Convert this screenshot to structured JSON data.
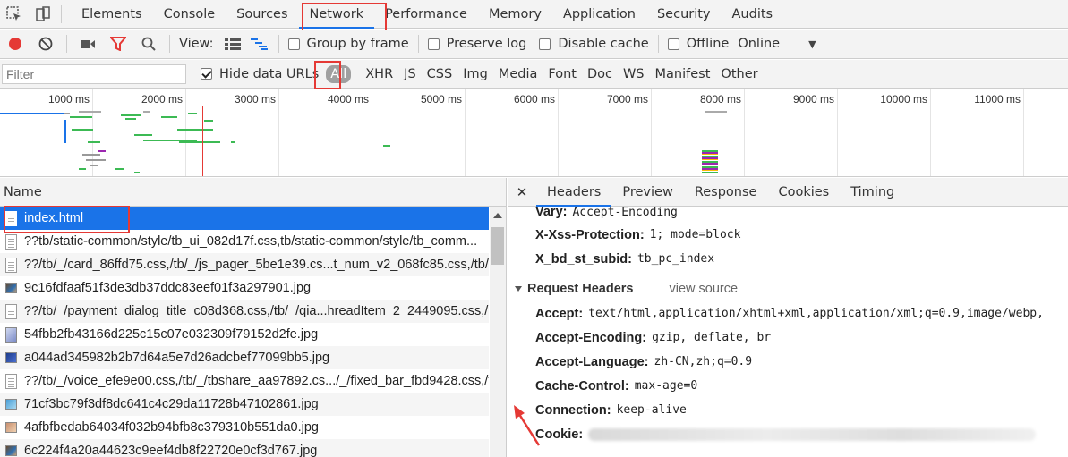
{
  "tabbar": {
    "tabs": [
      {
        "label": "Elements"
      },
      {
        "label": "Console"
      },
      {
        "label": "Sources"
      },
      {
        "label": "Network"
      },
      {
        "label": "Performance"
      },
      {
        "label": "Memory"
      },
      {
        "label": "Application"
      },
      {
        "label": "Security"
      },
      {
        "label": "Audits"
      }
    ],
    "active_tab": "Network"
  },
  "toolbar": {
    "view_label": "View:",
    "group_by_frame": "Group by frame",
    "preserve_log": "Preserve log",
    "disable_cache": "Disable cache",
    "offline": "Offline",
    "throttle": "Online"
  },
  "filterbar": {
    "placeholder": "Filter",
    "hide_data_urls": "Hide data URLs",
    "types": [
      "All",
      "XHR",
      "JS",
      "CSS",
      "Img",
      "Media",
      "Font",
      "Doc",
      "WS",
      "Manifest",
      "Other"
    ],
    "active_type": "All"
  },
  "overview": {
    "ticks": [
      "1000 ms",
      "2000 ms",
      "3000 ms",
      "4000 ms",
      "5000 ms",
      "6000 ms",
      "7000 ms",
      "8000 ms",
      "9000 ms",
      "10000 ms",
      "11000 ms"
    ]
  },
  "requests": {
    "column": "Name",
    "rows": [
      {
        "name": "index.html",
        "type": "doc"
      },
      {
        "name": "??tb/static-common/style/tb_ui_082d17f.css,tb/static-common/style/tb_comm...",
        "type": "doc"
      },
      {
        "name": "??/tb/_/card_86ffd75.css,/tb/_/js_pager_5be1e39.cs...t_num_v2_068fc85.css,/tb/",
        "type": "doc"
      },
      {
        "name": "9c16fdfaaf51f3de3db37ddc83eef01f3a297901.jpg",
        "type": "img"
      },
      {
        "name": "??/tb/_/payment_dialog_title_c08d368.css,/tb/_/qia...hreadItem_2_2449095.css,/",
        "type": "doc"
      },
      {
        "name": "54fbb2fb43166d225c15c07e032309f79152d2fe.jpg",
        "type": "img"
      },
      {
        "name": "a044ad345982b2b7d64a5e7d26adcbef77099bb5.jpg",
        "type": "img"
      },
      {
        "name": "??/tb/_/voice_efe9e00.css,/tb/_/tbshare_aa97892.cs.../_/fixed_bar_fbd9428.css,/t",
        "type": "doc"
      },
      {
        "name": "71cf3bc79f3df8dc641c4c29da11728b47102861.jpg",
        "type": "img"
      },
      {
        "name": "4afbfbedab64034f032b94bfb8c379310b551da0.jpg",
        "type": "img"
      },
      {
        "name": "6c224f4a20a44623c9eef4db8f22720e0cf3d767.jpg",
        "type": "img"
      }
    ]
  },
  "details": {
    "tabs": [
      "Headers",
      "Preview",
      "Response",
      "Cookies",
      "Timing"
    ],
    "active_tab": "Headers",
    "response_headers": [
      {
        "name": "Vary:",
        "value": "Accept-Encoding"
      },
      {
        "name": "X-Xss-Protection:",
        "value": "1; mode=block"
      },
      {
        "name": "X_bd_st_subid:",
        "value": "tb_pc_index"
      }
    ],
    "request_section": "Request Headers",
    "view_source": "view source",
    "request_headers": [
      {
        "name": "Accept:",
        "value": "text/html,application/xhtml+xml,application/xml;q=0.9,image/webp,"
      },
      {
        "name": "Accept-Encoding:",
        "value": "gzip, deflate, br"
      },
      {
        "name": "Accept-Language:",
        "value": "zh-CN,zh;q=0.9"
      },
      {
        "name": "Cache-Control:",
        "value": "max-age=0"
      },
      {
        "name": "Connection:",
        "value": "keep-alive"
      },
      {
        "name": "Cookie:",
        "value": ""
      }
    ]
  },
  "colors": {
    "accent": "#1a73e8",
    "record": "#e53935",
    "filter_icon": "#e53935",
    "annotation": "#e53935"
  }
}
